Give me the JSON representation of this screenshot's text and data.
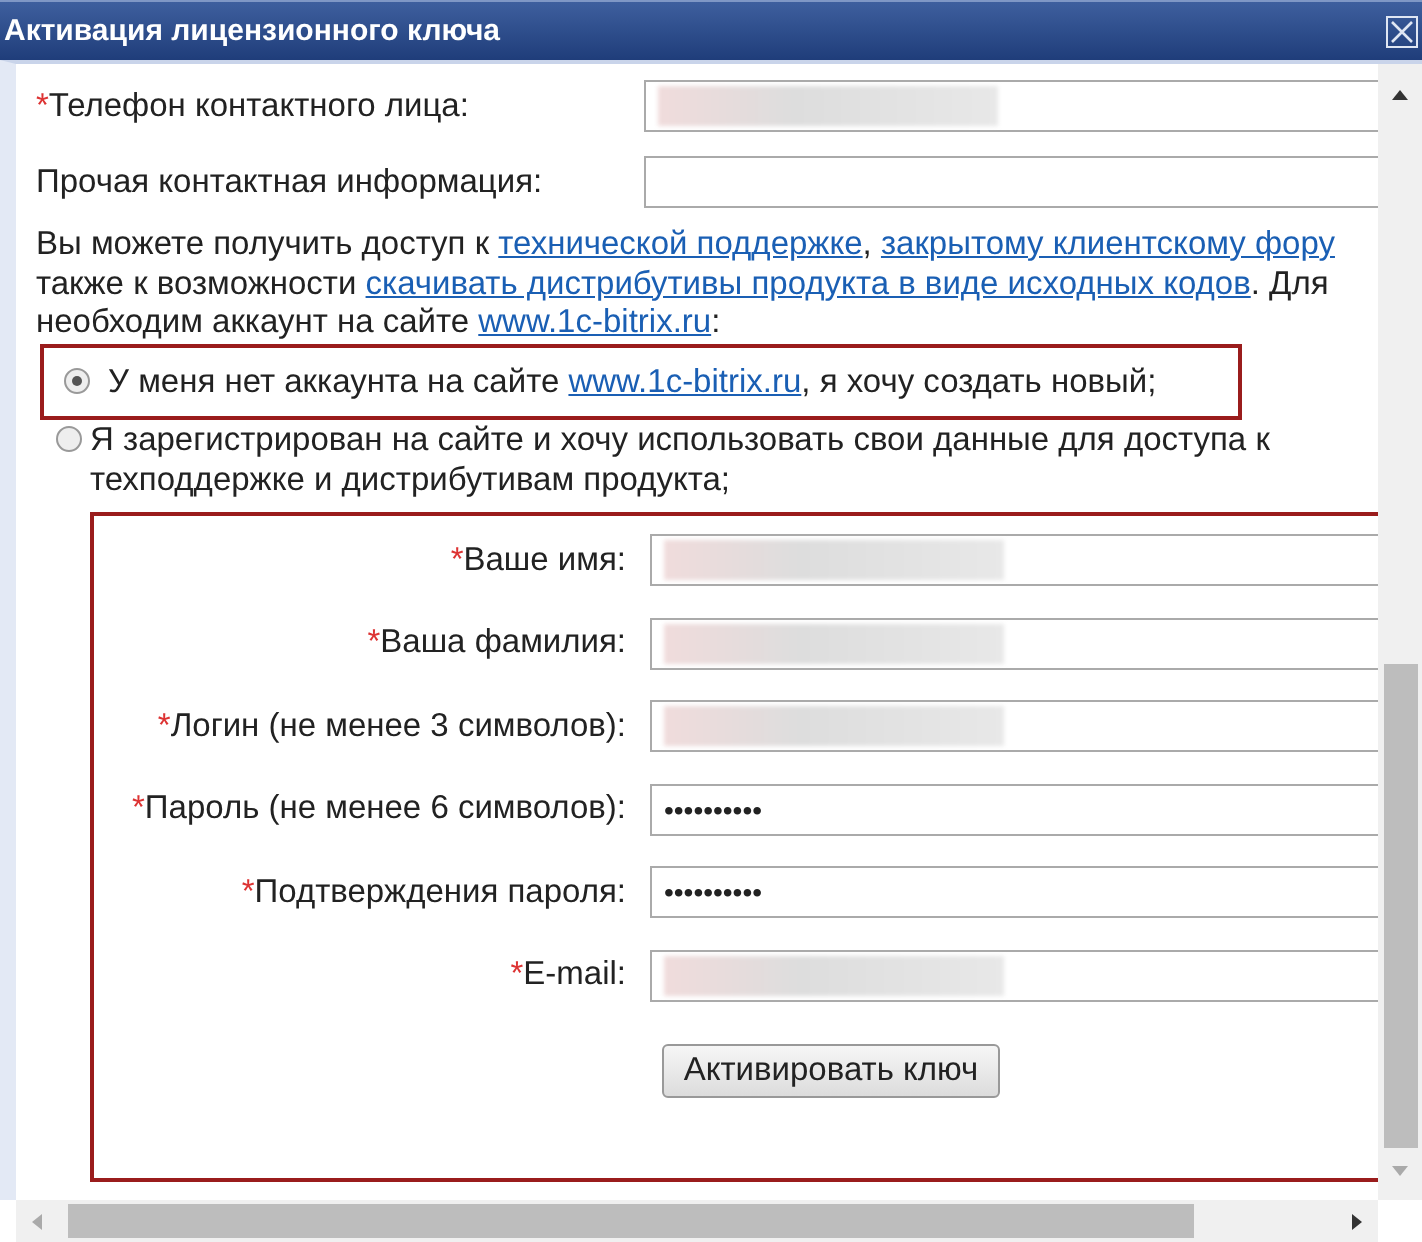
{
  "window": {
    "title": "Активация лицензионного ключа"
  },
  "contact_fields": [
    {
      "required_mark": "*",
      "label": "Телефон контактного лица:",
      "kind": "redacted"
    },
    {
      "label": "Прочая контактная информация:",
      "kind": "empty"
    }
  ],
  "info_lines": [
    [
      {
        "text": "Вы можете получить доступ к ",
        "kind": "text"
      },
      {
        "text": "технической поддержке",
        "kind": "link"
      },
      {
        "text": ", ",
        "kind": "text"
      },
      {
        "text": "закрытому клиентскому фору",
        "kind": "link"
      }
    ],
    [
      {
        "text": "также к возможности ",
        "kind": "text"
      },
      {
        "text": "скачивать дистрибутивы продукта в виде исходных кодов",
        "kind": "link"
      },
      {
        "text": ". Для",
        "kind": "text"
      }
    ],
    [
      {
        "text": "необходим аккаунт на сайте ",
        "kind": "text"
      },
      {
        "text": "www.1c-bitrix.ru",
        "kind": "link"
      },
      {
        "text": ":",
        "kind": "text"
      }
    ]
  ],
  "account_options": [
    {
      "selected": true,
      "highlighted": true,
      "parts": [
        {
          "text": "У меня нет аккаунта на сайте ",
          "kind": "text"
        },
        {
          "text": "www.1c-bitrix.ru",
          "kind": "link"
        },
        {
          "text": ", я хочу создать новый;",
          "kind": "text"
        }
      ]
    },
    {
      "selected": false,
      "highlighted": false,
      "parts": [
        {
          "text": "Я зарегистрирован на сайте и хочу использовать свои данные для доступа к техподдержке и дистрибутивам продукта;",
          "kind": "text"
        }
      ]
    }
  ],
  "registration_fields": [
    {
      "required_mark": "*",
      "label": "Ваше имя:",
      "kind": "redacted"
    },
    {
      "required_mark": "*",
      "label": "Ваша фамилия:",
      "kind": "redacted"
    },
    {
      "required_mark": "*",
      "label": "Логин (не менее 3 символов):",
      "kind": "redacted"
    },
    {
      "required_mark": "*",
      "label": "Пароль (не менее 6 символов):",
      "kind": "masked",
      "value": "••••••••••"
    },
    {
      "required_mark": "*",
      "label": "Подтверждения пароля:",
      "kind": "masked",
      "value": "••••••••••"
    },
    {
      "required_mark": "*",
      "label": "E-mail:",
      "kind": "redacted"
    }
  ],
  "activate_button": "Активировать ключ"
}
